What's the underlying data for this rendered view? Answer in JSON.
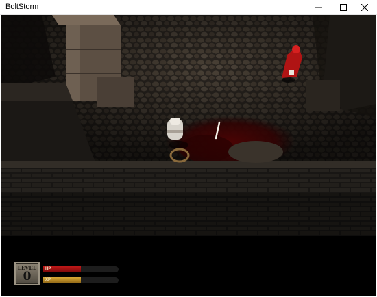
{
  "window": {
    "title": "BoltStorm"
  },
  "controls": {
    "minimize": "minimize-icon",
    "maximize": "maximize-icon",
    "close": "close-icon"
  },
  "hud": {
    "level_label": "LEVEL",
    "level_value": "0",
    "hp": {
      "label": "HP",
      "fill_fraction": 0.5,
      "color": "#b01414"
    },
    "xp": {
      "label": "XP",
      "fill_fraction": 0.5,
      "color": "#c89a2c"
    }
  }
}
